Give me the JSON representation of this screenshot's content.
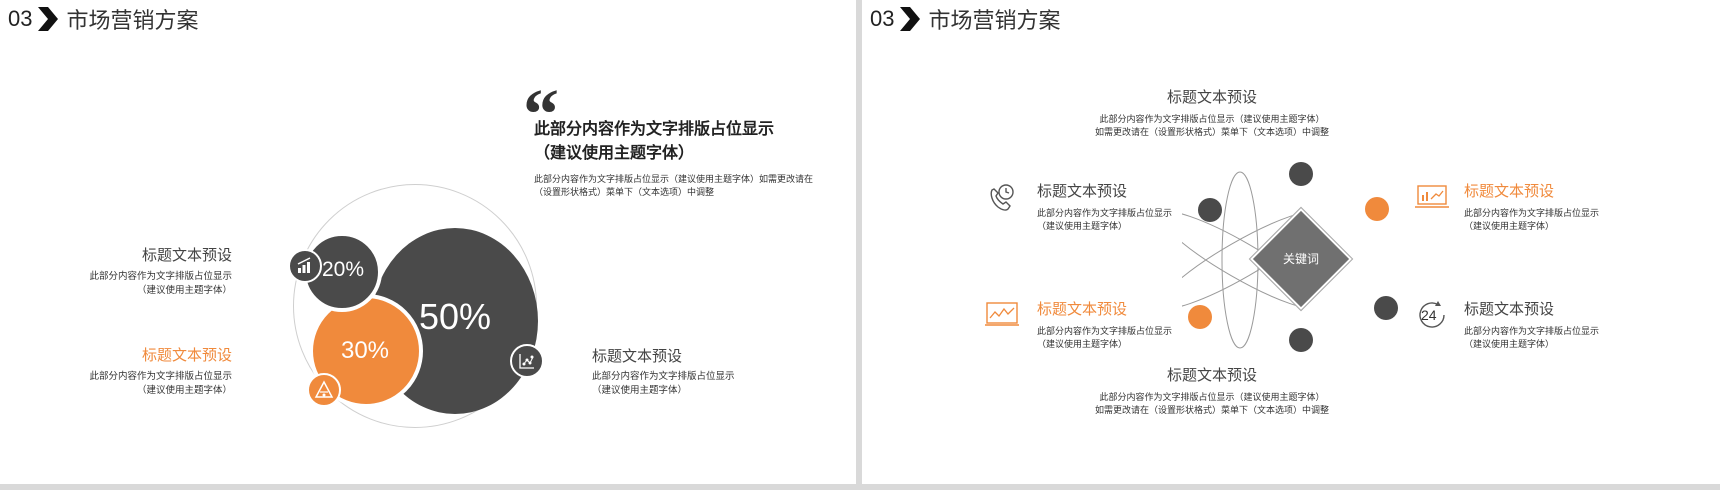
{
  "left_slide": {
    "header": {
      "number": "03",
      "title": "市场营销方案"
    },
    "quote": {
      "title_line1": "此部分内容作为文字排版占位显示",
      "title_line2": "（建议使用主题字体）",
      "body_line1": "此部分内容作为文字排版占位显示（建议使用主题字体）如需更改请在",
      "body_line2": "（设置形状格式）菜单下（文本选项）中调整"
    },
    "items": [
      {
        "title": "标题文本预设",
        "line1": "此部分内容作为文字排版占位显示",
        "line2": "（建议使用主题字体）"
      },
      {
        "title": "标题文本预设",
        "line1": "此部分内容作为文字排版占位显示",
        "line2": "（建议使用主题字体）"
      },
      {
        "title": "标题文本预设",
        "line1": "此部分内容作为文字排版占位显示",
        "line2": "（建议使用主题字体）"
      }
    ],
    "percentages": {
      "small": "20%",
      "medium": "30%",
      "large": "50%"
    },
    "icons": [
      "bar-chart-growth-icon",
      "pyramid-icon",
      "scatter-chart-icon"
    ]
  },
  "right_slide": {
    "header": {
      "number": "03",
      "title": "市场营销方案"
    },
    "center_keyword": "关键词",
    "top": {
      "title": "标题文本预设",
      "line1": "此部分内容作为文字排版占位显示（建议使用主题字体）",
      "line2": "如需更改请在（设置形状格式）菜单下（文本选项）中调整"
    },
    "bottom": {
      "title": "标题文本预设",
      "line1": "此部分内容作为文字排版占位显示（建议使用主题字体）",
      "line2": "如需更改请在（设置形状格式）菜单下（文本选项）中调整"
    },
    "side_items": [
      {
        "title": "标题文本预设",
        "line1": "此部分内容作为文字排版占位显示",
        "line2": "（建议使用主题字体）"
      },
      {
        "title": "标题文本预设",
        "line1": "此部分内容作为文字排版占位显示",
        "line2": "（建议使用主题字体）"
      },
      {
        "title": "标题文本预设",
        "line1": "此部分内容作为文字排版占位显示",
        "line2": "（建议使用主题字体）"
      },
      {
        "title": "标题文本预设",
        "line1": "此部分内容作为文字排版占位显示",
        "line2": "（建议使用主题字体）"
      }
    ],
    "icon_24_label": "24",
    "icons": [
      "phone-clock-icon",
      "presentation-chart-icon",
      "monitor-chart-icon",
      "24-hours-icon"
    ]
  },
  "colors": {
    "accent": "#f08a3c",
    "dark": "#4a4a4a",
    "gray": "#777777"
  }
}
